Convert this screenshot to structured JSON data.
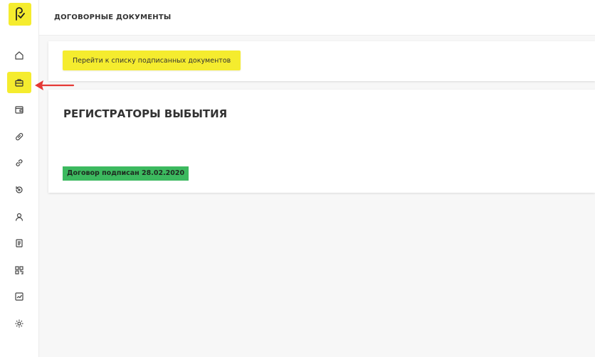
{
  "header": {
    "title": "ДОГОВОРНЫЕ ДОКУМЕНТЫ"
  },
  "actions": {
    "signed_list_label": "Перейти к списку подписанных документов"
  },
  "section": {
    "title": "РЕГИСТРАТОРЫ ВЫБЫТИЯ",
    "status_badge": "Договор подписан 28.02.2020"
  },
  "sidebar": {
    "items": [
      {
        "icon": "home-icon"
      },
      {
        "icon": "briefcase-icon",
        "active": true
      },
      {
        "icon": "wallet-icon"
      },
      {
        "icon": "pill-icon"
      },
      {
        "icon": "link-icon"
      },
      {
        "icon": "return-icon"
      },
      {
        "icon": "user-icon"
      },
      {
        "icon": "document-icon"
      },
      {
        "icon": "qr-code-icon"
      },
      {
        "icon": "chart-icon"
      },
      {
        "icon": "gear-icon"
      }
    ]
  },
  "colors": {
    "accent": "#f5ec2e",
    "success": "#3cb95f",
    "pointer": "#e53935"
  }
}
